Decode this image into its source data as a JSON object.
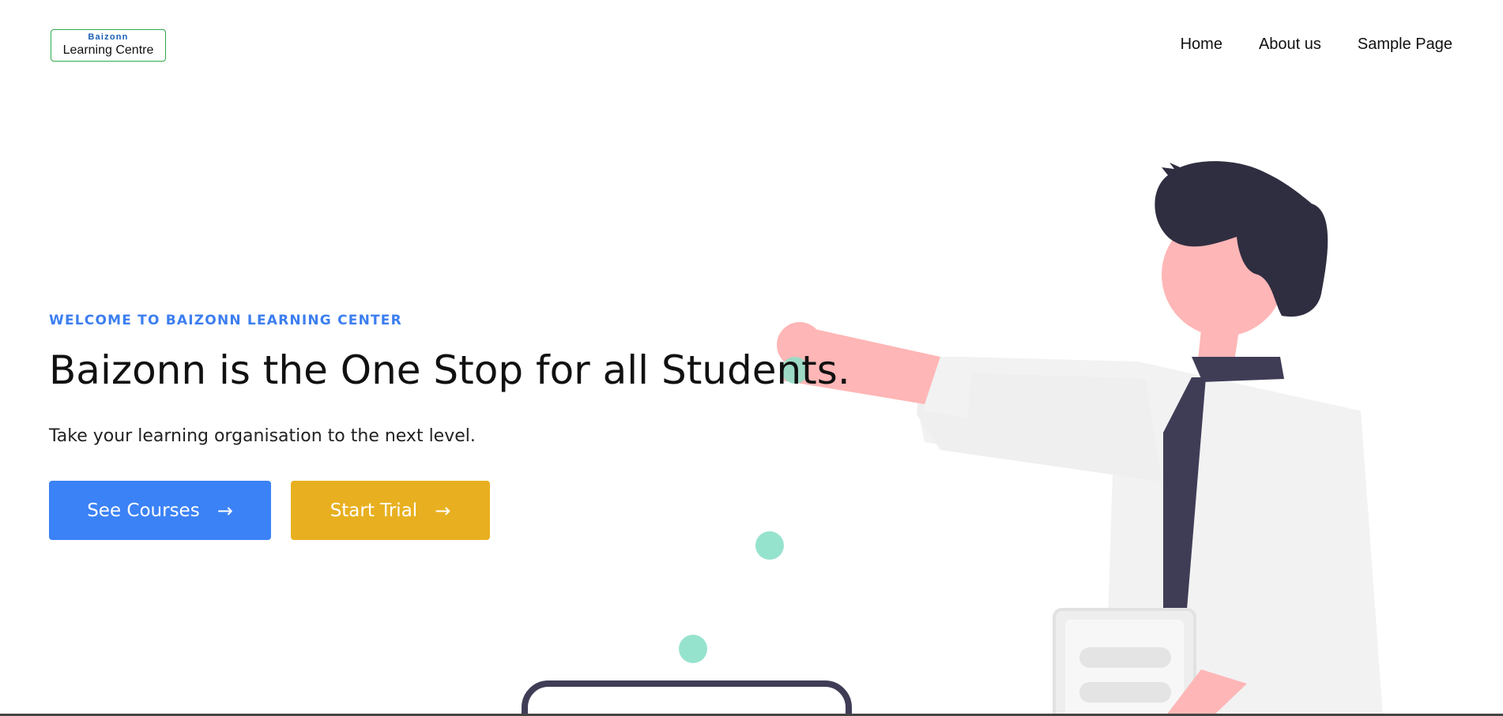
{
  "header": {
    "logo": {
      "line1": "Baizonn",
      "line2": "Learning Centre"
    },
    "nav": [
      "Home",
      "About us",
      "Sample Page"
    ]
  },
  "hero": {
    "kicker": "WELCOME TO BAIZONN LEARNING CENTER",
    "title": "Baizonn is the One Stop for all Students.",
    "subtitle": "Take your learning organisation to the next level.",
    "buttons": {
      "primary": "See Courses",
      "secondary": "Start Trial",
      "arrow": "→"
    }
  },
  "colors": {
    "accent_blue": "#3b82f6",
    "accent_yellow": "#e8b020",
    "kicker_blue": "#3c7ef0",
    "logo_border": "#2faa4a",
    "hair": "#2f2e41",
    "skin": "#ffb6b6",
    "shirt": "#f2f2f2",
    "tie": "#3f3d56",
    "dots": "#8be0c8"
  }
}
